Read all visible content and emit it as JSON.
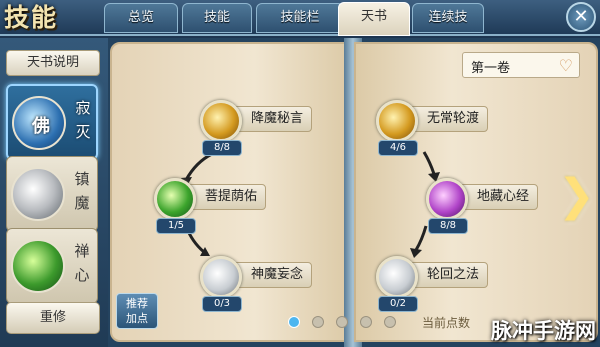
{
  "header": {
    "title": "技能",
    "tabs": [
      {
        "label": "总览",
        "active": false
      },
      {
        "label": "技能",
        "active": false
      },
      {
        "label": "技能栏",
        "active": false
      },
      {
        "label": "天书",
        "active": true
      },
      {
        "label": "连续技",
        "active": false
      }
    ],
    "close_icon": "close-icon"
  },
  "sidebar": {
    "desc_button": "天书说明",
    "schools": [
      {
        "name": "寂灭",
        "glyph": "佛",
        "icon": "lotus-icon",
        "active": true
      },
      {
        "name": "镇魔",
        "glyph": "",
        "icon": "cloud-icon",
        "active": false
      },
      {
        "name": "禅心",
        "glyph": "",
        "icon": "leaf-icon",
        "active": false
      }
    ],
    "reset_button": "重修"
  },
  "book": {
    "volume": "第一卷",
    "volume_icon": "heart-icon",
    "skills": [
      {
        "name": "降魔秘言",
        "count": "8/8",
        "color": "#d49a20"
      },
      {
        "name": "菩提荫佑",
        "count": "1/5",
        "color": "#3ca42c"
      },
      {
        "name": "神魔妄念",
        "count": "0/3",
        "color": "#c8cdd2"
      },
      {
        "name": "无常轮渡",
        "count": "4/6",
        "color": "#d49a20"
      },
      {
        "name": "地藏心经",
        "count": "8/8",
        "color": "#b044c8"
      },
      {
        "name": "轮回之法",
        "count": "0/2",
        "color": "#c8cdd2"
      }
    ],
    "recommend_button": "推荐\n加点",
    "recommend_line1": "推荐",
    "recommend_line2": "加点",
    "points_label": "当前点数",
    "page_count": 5,
    "current_page": 1,
    "next_icon": "chevron-right-icon"
  },
  "watermark": "脉冲手游网"
}
